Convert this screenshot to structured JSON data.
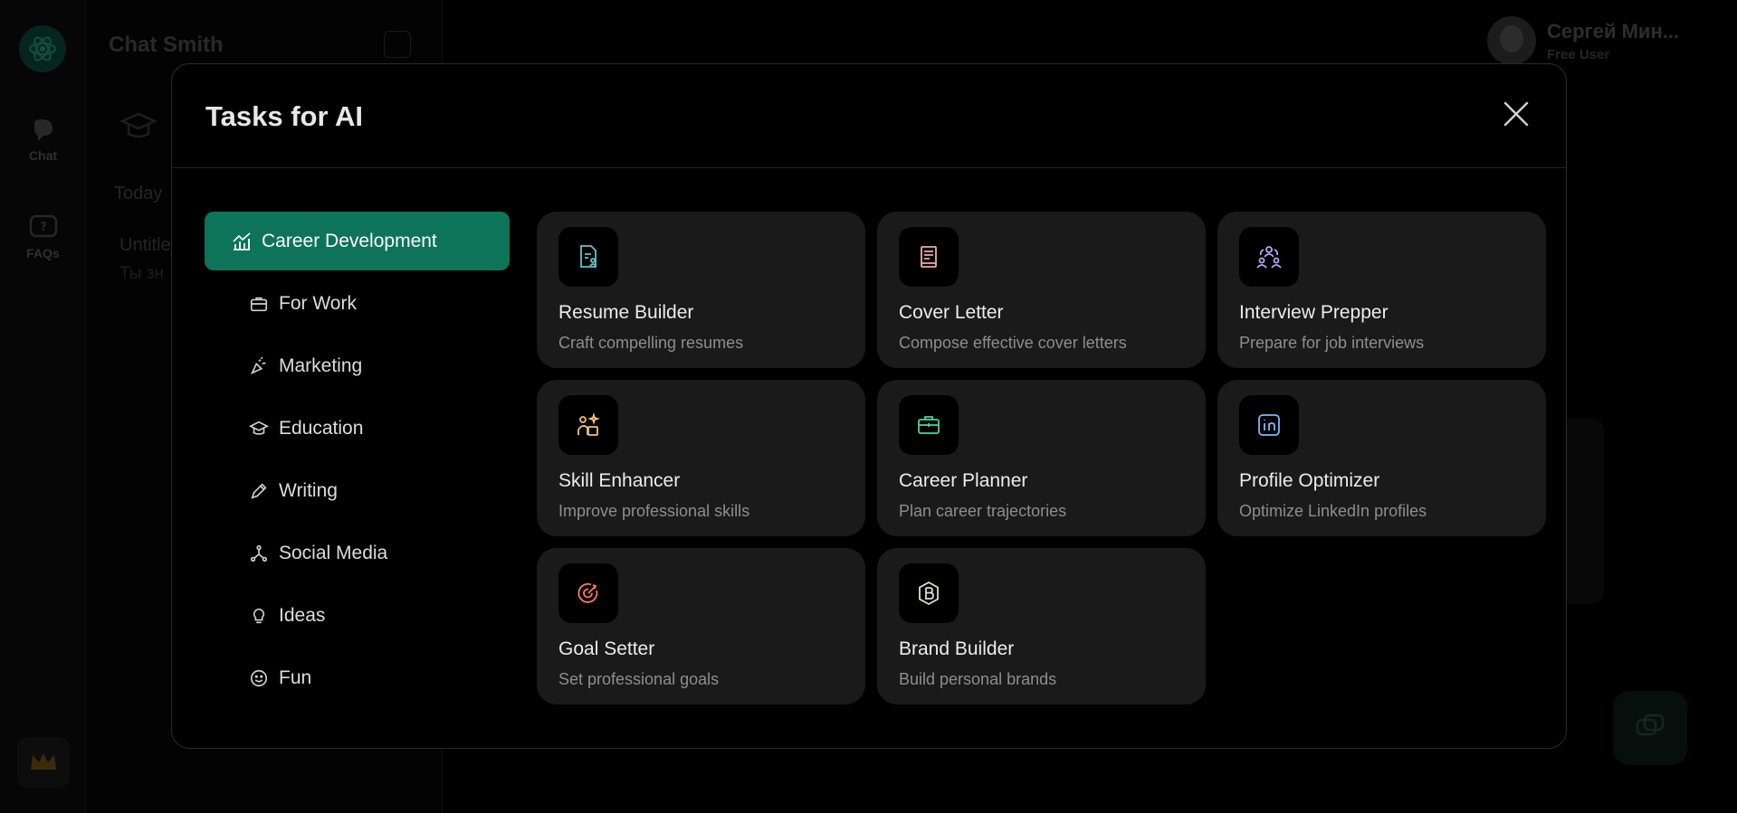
{
  "app": {
    "title": "Chat Smith",
    "rail": {
      "chat_label": "Chat",
      "faqs_label": "FAQs"
    },
    "sidebar": {
      "section_today": "Today",
      "chat_title": "Untitle",
      "chat_preview": "Ты зн"
    },
    "user": {
      "name": "Сергей Мин...",
      "plan": "Free User"
    }
  },
  "modal": {
    "title": "Tasks for AI",
    "close_icon": "close-icon",
    "categories": [
      {
        "label": "Career Development",
        "icon": "chart-icon",
        "active": true
      },
      {
        "label": "For Work",
        "icon": "briefcase-icon"
      },
      {
        "label": "Marketing",
        "icon": "megaphone-icon"
      },
      {
        "label": "Education",
        "icon": "graduation-cap-icon"
      },
      {
        "label": "Writing",
        "icon": "pen-icon"
      },
      {
        "label": "Social Media",
        "icon": "network-icon"
      },
      {
        "label": "Ideas",
        "icon": "lightbulb-icon"
      },
      {
        "label": "Fun",
        "icon": "smile-icon"
      }
    ],
    "tasks": [
      {
        "title": "Resume Builder",
        "desc": "Craft compelling resumes",
        "icon": "resume-icon",
        "color": "#5ec6c6"
      },
      {
        "title": "Cover Letter",
        "desc": "Compose effective cover letters",
        "icon": "document-icon",
        "color": "#f0a8b0"
      },
      {
        "title": "Interview Prepper",
        "desc": "Prepare for job interviews",
        "icon": "people-icon",
        "color": "#b7a6f5"
      },
      {
        "title": "Skill Enhancer",
        "desc": "Improve professional skills",
        "icon": "skill-icon",
        "color": "#f2c27a"
      },
      {
        "title": "Career Planner",
        "desc": "Plan career trajectories",
        "icon": "briefcase-icon",
        "color": "#4fd1a5"
      },
      {
        "title": "Profile Optimizer",
        "desc": "Optimize LinkedIn profiles",
        "icon": "linkedin-icon",
        "color": "#7fb6ff"
      },
      {
        "title": "Goal Setter",
        "desc": "Set professional goals",
        "icon": "target-icon",
        "color": "#ff7a5c"
      },
      {
        "title": "Brand Builder",
        "desc": "Build personal brands",
        "icon": "brand-icon",
        "color": "#e8d8d8"
      }
    ]
  },
  "colors": {
    "accent": "#0d7459",
    "card_bg": "#1a1a1a",
    "modal_bg": "#000000"
  }
}
